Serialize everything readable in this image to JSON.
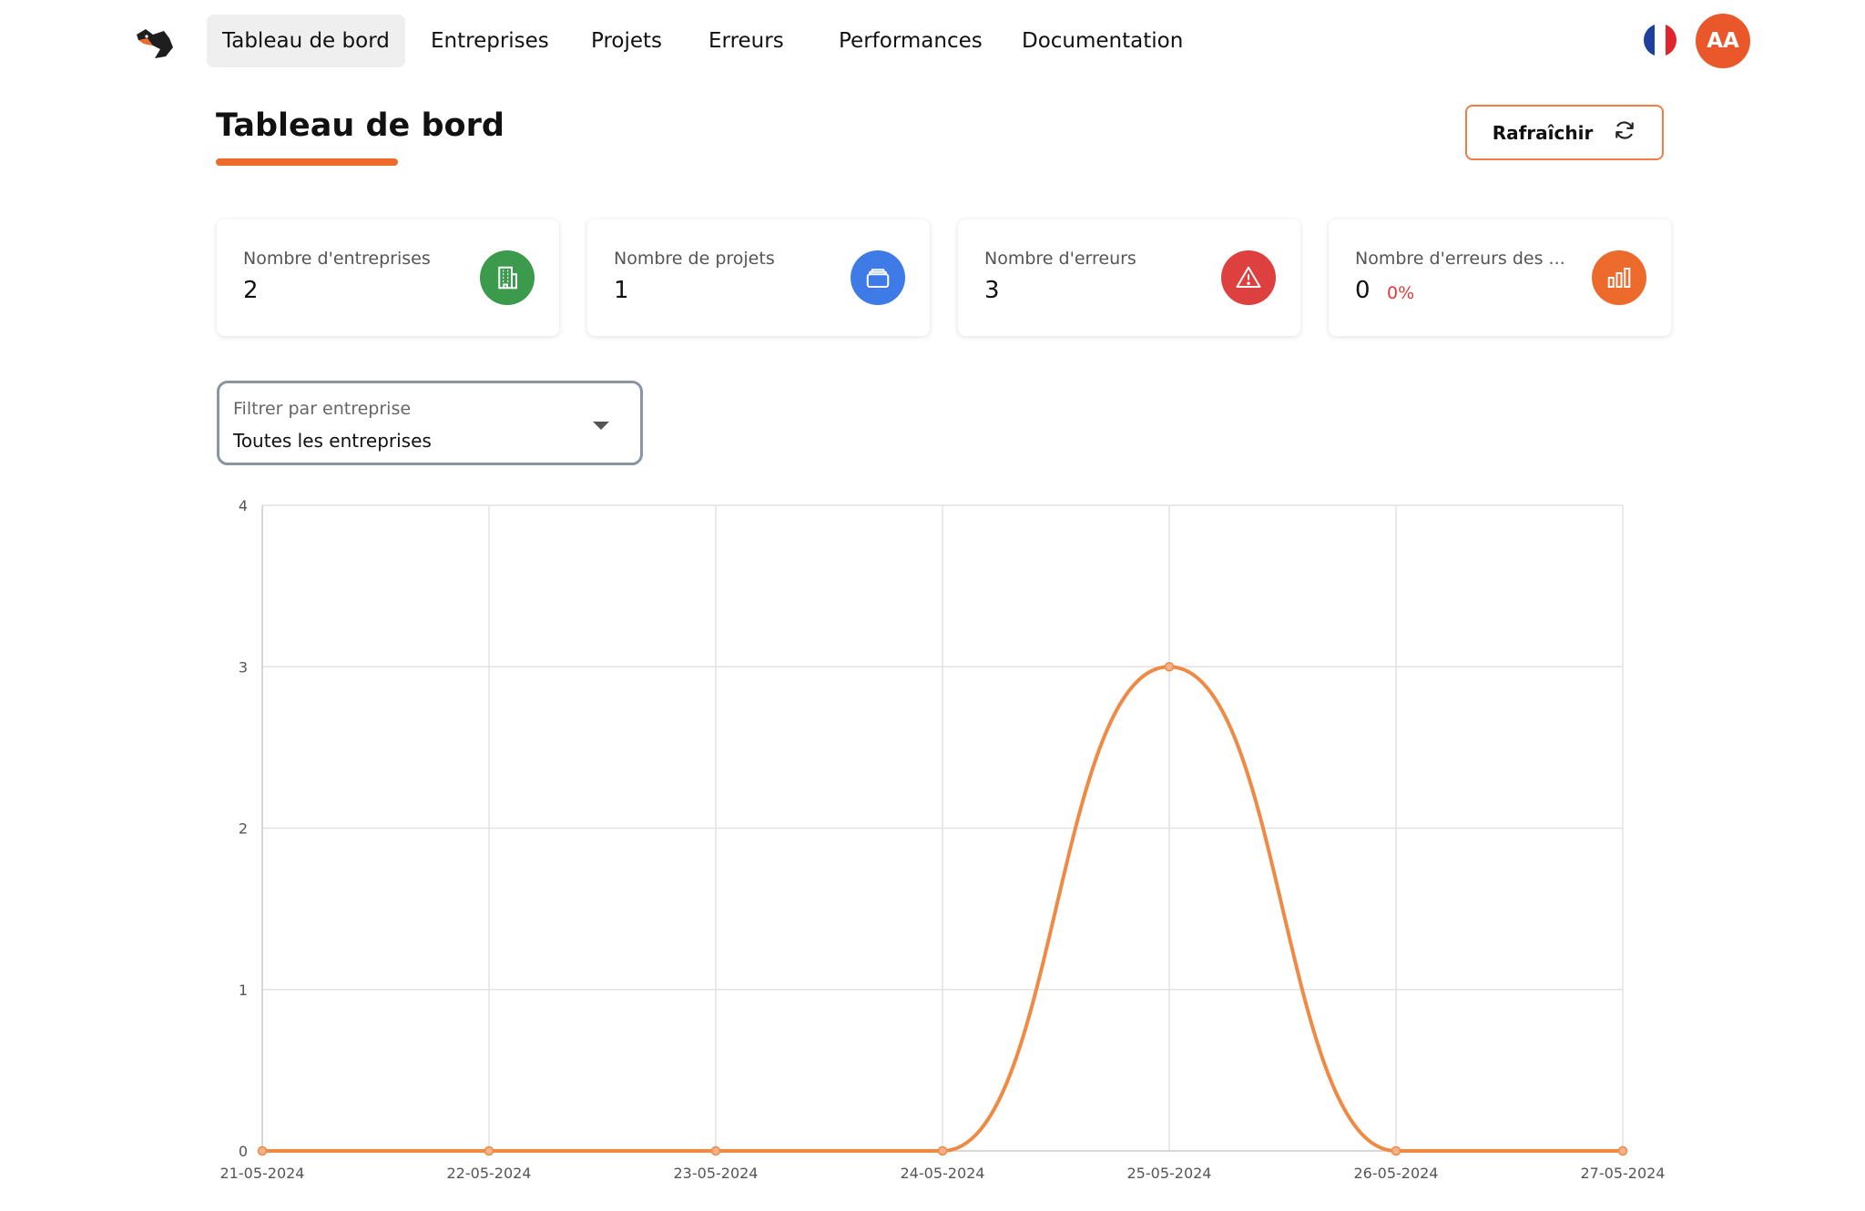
{
  "nav": {
    "logo_icon": "fox-logo-icon",
    "items": [
      {
        "label": "Tableau de bord",
        "active": true
      },
      {
        "label": "Entreprises",
        "active": false
      },
      {
        "label": "Projets",
        "active": false
      },
      {
        "label": "Erreurs",
        "active": false
      },
      {
        "label": "Performances",
        "active": false
      },
      {
        "label": "Documentation",
        "active": false
      }
    ],
    "language_icon": "france-flag-icon",
    "avatar_initials": "AA"
  },
  "header": {
    "title": "Tableau de bord",
    "refresh_label": "Rafraîchir",
    "refresh_icon": "refresh-icon"
  },
  "stats": [
    {
      "label": "Nombre d'entreprises",
      "value": "2",
      "icon": "building-icon",
      "color": "#3b9a4b"
    },
    {
      "label": "Nombre de projets",
      "value": "1",
      "icon": "folder-icon",
      "color": "#3f7be6"
    },
    {
      "label": "Nombre d'erreurs",
      "value": "3",
      "icon": "warning-icon",
      "color": "#de3f3f"
    },
    {
      "label": "Nombre d'erreurs des ...",
      "value": "0",
      "sub": "0%",
      "icon": "bar-chart-icon",
      "color": "#ec6a2c"
    }
  ],
  "filter": {
    "label": "Filtrer par entreprise",
    "value": "Toutes les entreprises"
  },
  "colors": {
    "accent": "#ec6a2c",
    "series": "#ef8a45"
  },
  "chart_data": {
    "type": "line",
    "title": "",
    "xlabel": "",
    "ylabel": "",
    "categories": [
      "21-05-2024",
      "22-05-2024",
      "23-05-2024",
      "24-05-2024",
      "25-05-2024",
      "26-05-2024",
      "27-05-2024"
    ],
    "series": [
      {
        "values": [
          0,
          0,
          0,
          0,
          3,
          0,
          0
        ]
      }
    ],
    "ylim": [
      0,
      4
    ],
    "yticks": [
      "0",
      "1",
      "2",
      "3",
      "4"
    ],
    "grid": true,
    "smooth": true
  }
}
